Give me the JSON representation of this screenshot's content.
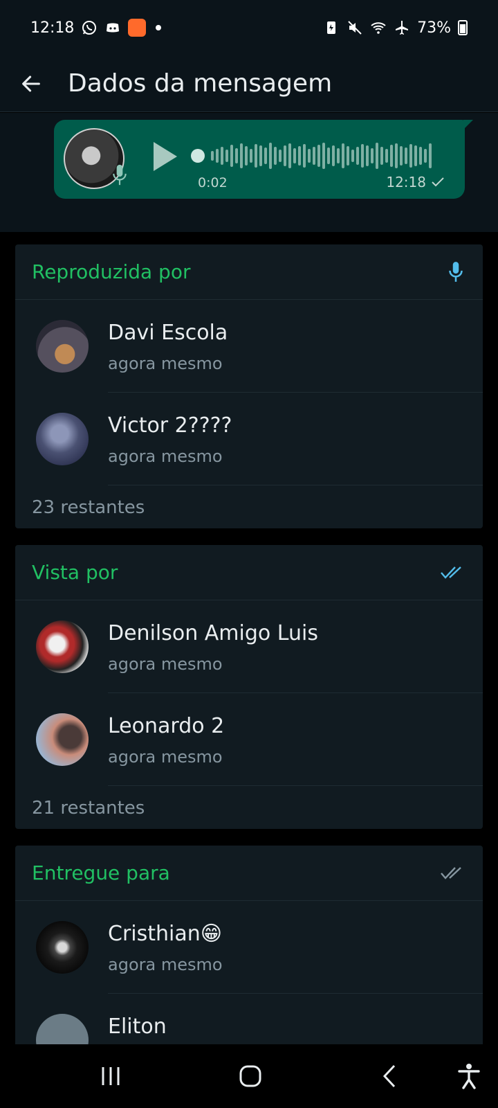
{
  "status_bar": {
    "time": "12:18",
    "battery": "73%",
    "icons": [
      "whatsapp-icon",
      "discord-icon",
      "app-icon",
      "notification-dot-icon",
      "battery-saver-icon",
      "mute-icon",
      "wifi-icon",
      "airplane-icon",
      "battery-icon"
    ]
  },
  "appbar": {
    "title": "Dados da mensagem"
  },
  "message": {
    "duration": "0:02",
    "time": "12:18"
  },
  "sections": {
    "played": {
      "title": "Reproduzida por",
      "people": [
        {
          "name": "Davi Escola",
          "time": "agora mesmo"
        },
        {
          "name": "Victor 2????",
          "time": "agora mesmo"
        }
      ],
      "remaining": "23 restantes"
    },
    "seen": {
      "title": "Vista por",
      "people": [
        {
          "name": "Denilson Amigo Luis",
          "time": "agora mesmo"
        },
        {
          "name": "Leonardo 2",
          "time": "agora mesmo"
        }
      ],
      "remaining": "21 restantes"
    },
    "delivered": {
      "title": "Entregue para",
      "people": [
        {
          "name": "Cristhian😁",
          "time": "agora mesmo"
        },
        {
          "name": "Eliton",
          "time": ""
        }
      ]
    }
  },
  "colors": {
    "accent_green": "#21c063",
    "bubble_green": "#005c4b",
    "read_blue": "#53bdeb",
    "mic_blue": "#53bdeb"
  }
}
